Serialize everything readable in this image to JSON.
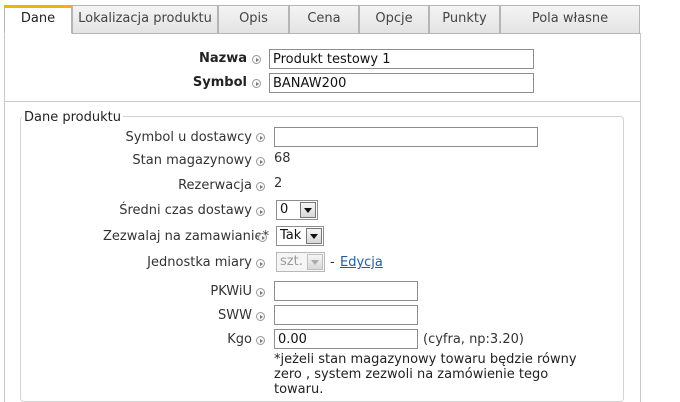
{
  "tabs": [
    {
      "label": "Dane",
      "active": true
    },
    {
      "label": "Lokalizacja produktu"
    },
    {
      "label": "Opis"
    },
    {
      "label": "Cena"
    },
    {
      "label": "Opcje"
    },
    {
      "label": "Punkty"
    },
    {
      "label": "Pola własne"
    }
  ],
  "header_fields": {
    "name_label": "Nazwa",
    "name_value": "Produkt testowy 1",
    "symbol_label": "Symbol",
    "symbol_value": "BANAW200"
  },
  "product_data": {
    "legend": "Dane produktu",
    "supplier_symbol_label": "Symbol u dostawcy",
    "supplier_symbol_value": "",
    "stock_label": "Stan magazynowy",
    "stock_value": "68",
    "reservation_label": "Rezerwacja",
    "reservation_value": "2",
    "delivery_time_label": "Średni czas dostawy",
    "delivery_time_value": "0",
    "allow_order_label": "Zezwalaj na zamawianie*",
    "allow_order_value": "Tak",
    "unit_label": "Jednostka miary",
    "unit_value": "szt.",
    "unit_sep": "-",
    "unit_edit_link": "Edycja",
    "pkwiu_label": "PKWiU",
    "pkwiu_value": "",
    "sww_label": "SWW",
    "sww_value": "",
    "kgo_label": "Kgo",
    "kgo_value": "0.00",
    "kgo_hint": "(cyfra, np:3.20)",
    "footnote": "*jeżeli stan magazynowy towaru będzie równy zero , system zezwoli na zamówienie tego towaru."
  },
  "colors": {
    "active_tab_accent": "#f0b400",
    "link": "#1f5fa5"
  },
  "icons": {
    "field_help": "arrow-circle-icon",
    "dropdown": "chevron-down-icon"
  }
}
